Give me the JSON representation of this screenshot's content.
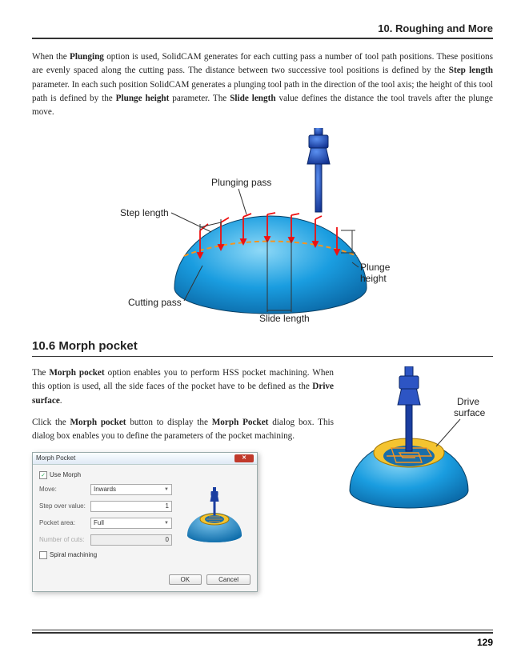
{
  "header": {
    "chapter": "10. Roughing and More"
  },
  "para1": {
    "t1": "When the ",
    "b1": "Plunging",
    "t2": " option is used, SolidCAM generates for each cutting pass a number of tool path positions. These positions are evenly spaced along the cutting pass. The distance between two successive tool positions is defined by the ",
    "b2": "Step length",
    "t3": " parameter. In each such position SolidCAM generates a plunging tool path in the direction of the tool axis; the height of this tool path is defined by the ",
    "b3": "Plunge height",
    "t4": " parameter. The ",
    "b4": "Slide length",
    "t5": " value defines the distance the tool travels after the plunge move."
  },
  "fig1": {
    "plunging_pass": "Plunging pass",
    "step_length": "Step length",
    "cutting_pass": "Cutting pass",
    "slide_length": "Slide length",
    "plunge_height": "Plunge\nheight"
  },
  "section": {
    "number": "10.6",
    "title": "Morph pocket"
  },
  "para2": {
    "t1": "The ",
    "b1": "Morph pocket",
    "t2": " option enables you to perform HSS pocket machining. When this option is used, all the side faces of the pocket have to be defined as the ",
    "b2": "Drive surface",
    "t3": "."
  },
  "para3": {
    "t1": "Click the ",
    "b1": "Morph pocket",
    "t2": " button to display the ",
    "b2": "Morph Pocket",
    "t3": " dialog box. This dialog box enables you to define the parameters of the pocket machining."
  },
  "fig2": {
    "drive_surface": "Drive\nsurface"
  },
  "dialog": {
    "title": "Morph Pocket",
    "use_morph": "Use Morph",
    "use_morph_checked": "✓",
    "move_label": "Move:",
    "move_value": "Inwards",
    "step_over_label": "Step over value:",
    "step_over_value": "1",
    "pocket_area_label": "Pocket area:",
    "pocket_area_value": "Full",
    "num_cuts_label": "Number of cuts:",
    "num_cuts_value": "0",
    "spiral_label": "Spiral machining",
    "ok": "OK",
    "cancel": "Cancel"
  },
  "page_number": "129"
}
